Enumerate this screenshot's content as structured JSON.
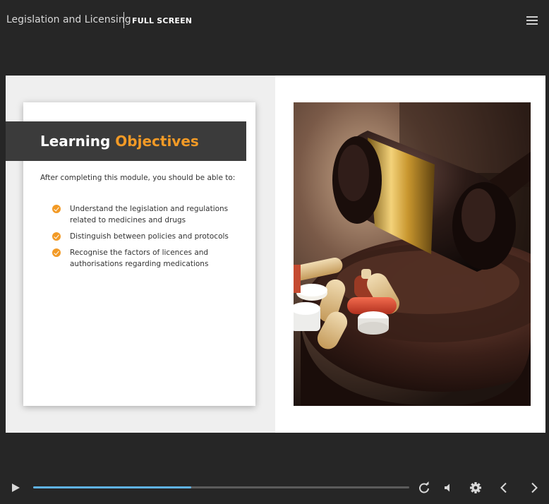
{
  "topbar": {
    "course_title": "Legislation and Licensing",
    "fullscreen_label": "FULL SCREEN",
    "menu_icon": "hamburger-menu-icon"
  },
  "slide": {
    "heading_main": "Learning",
    "heading_accent": "Objectives",
    "intro": "After  completing this module, you should be able to:",
    "objectives": [
      "Understand the legislation and regulations related to medicines and drugs",
      "Distinguish between policies and protocols",
      "Recognise the factors of licences and authorisations regarding medications"
    ],
    "image_icon": "gavel-and-pills-photo"
  },
  "player": {
    "progress": 0.42,
    "icons": [
      "play-icon",
      "replay-icon",
      "volume-icon",
      "settings-icon",
      "previous-icon",
      "next-icon"
    ]
  },
  "colors": {
    "accent": "#f29a26",
    "progress": "#5fb2e6",
    "background": "#262626",
    "heading_band": "#3b3b3b"
  }
}
